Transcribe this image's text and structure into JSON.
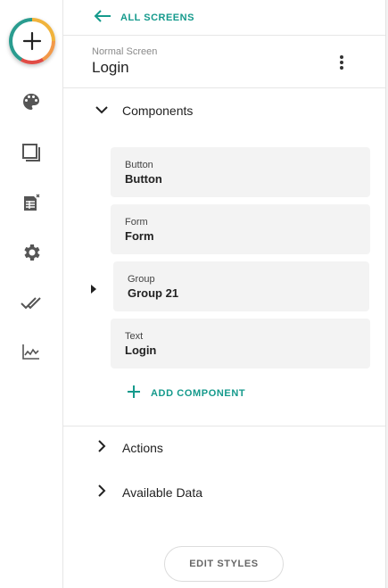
{
  "rail": {
    "items": [
      {
        "icon": "palette-icon"
      },
      {
        "icon": "screens-icon"
      },
      {
        "icon": "data-table-icon"
      },
      {
        "icon": "settings-gear-icon"
      },
      {
        "icon": "double-check-icon"
      },
      {
        "icon": "analytics-chart-icon"
      }
    ]
  },
  "header": {
    "back_label": "ALL SCREENS",
    "screen_kind": "Normal Screen",
    "screen_name": "Login"
  },
  "sections": {
    "components": "Components",
    "actions": "Actions",
    "available_data": "Available Data"
  },
  "components": [
    {
      "type": "Button",
      "name": "Button"
    },
    {
      "type": "Form",
      "name": "Form"
    },
    {
      "type": "Group",
      "name": "Group 21"
    },
    {
      "type": "Text",
      "name": "Login"
    }
  ],
  "add_component_label": "ADD COMPONENT",
  "edit_styles_label": "EDIT STYLES",
  "colors": {
    "accent": "#159a8c",
    "card_bg": "#f3f3f3",
    "text_dark": "#222222"
  }
}
